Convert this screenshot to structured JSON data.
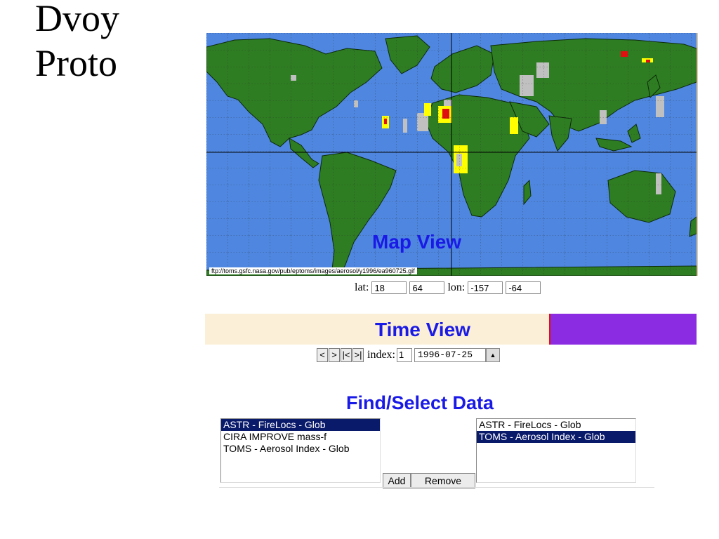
{
  "slide": {
    "title_line1": "Dvoy",
    "title_line2": "Proto"
  },
  "map": {
    "label": "Map View",
    "source_url": "ftp://toms.gsfc.nasa.gov/pub/eptoms/images/aerosol/y1996/ea960725.gif",
    "colors": {
      "ocean": "#4f87e0",
      "land": "#2e7d22",
      "aerosol_low": "#c0c0c0",
      "aerosol_mid": "#ffff00",
      "aerosol_high": "#e01010"
    }
  },
  "coords": {
    "lat_label": "lat:",
    "lat_min": "18",
    "lat_max": "64",
    "lon_label": "lon:",
    "lon_min": "-157",
    "lon_max": "-64"
  },
  "time": {
    "label": "Time View",
    "nav_prev": "<",
    "nav_next": ">",
    "nav_first": "|<",
    "nav_last": ">|",
    "index_label": "index:",
    "index_value": "1",
    "date_value": "1996-07-25",
    "spin_icon": "▲"
  },
  "find": {
    "title": "Find/Select Data",
    "available": [
      {
        "label": "ASTR - FireLocs - Glob",
        "selected": true
      },
      {
        "label": "CIRA IMPROVE mass-f",
        "selected": false
      },
      {
        "label": "TOMS - Aerosol Index - Glob",
        "selected": false
      }
    ],
    "chosen": [
      {
        "label": "ASTR - FireLocs - Glob",
        "selected": false
      },
      {
        "label": "TOMS - Aerosol Index - Glob",
        "selected": true
      }
    ],
    "add_label": "Add",
    "remove_label": "Remove"
  }
}
